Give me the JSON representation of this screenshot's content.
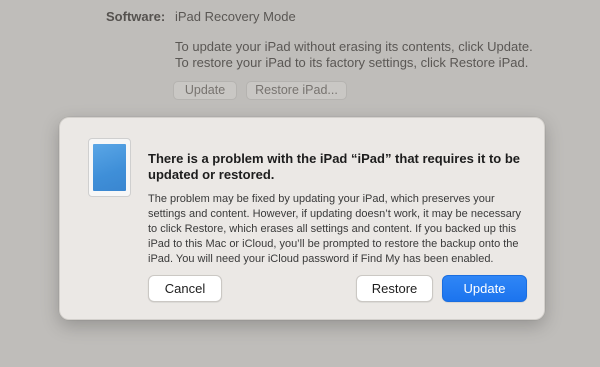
{
  "background": {
    "software_label": "Software:",
    "software_value": "iPad Recovery Mode",
    "description_line1": "To update your iPad without erasing its contents, click Update.",
    "description_line2": "To restore your iPad to its factory settings, click Restore iPad.",
    "update_button": "Update",
    "restore_button": "Restore iPad..."
  },
  "dialog": {
    "title": "There is a problem with the iPad “iPad” that requires it to be updated or restored.",
    "message": "The problem may be fixed by updating your iPad, which preserves your settings and content. However, if updating doesn’t work, it may be necessary to click Restore, which erases all settings and content. If you backed up this iPad to this Mac or iCloud, you’ll be prompted to restore the backup onto the iPad. You will need your iCloud password if Find My has been enabled.",
    "icon": "ipad-icon",
    "buttons": {
      "cancel": "Cancel",
      "restore": "Restore",
      "update": "Update"
    }
  },
  "colors": {
    "background": "#bfbdba",
    "sheet": "#ebe8e5",
    "accent": "#1c74ee"
  }
}
